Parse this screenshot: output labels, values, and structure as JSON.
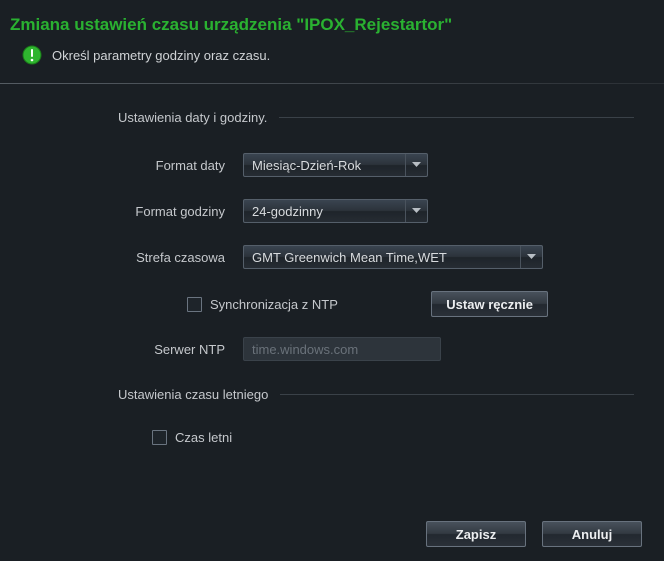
{
  "title": "Zmiana ustawień czasu urządzenia \"IPOX_Rejestartor\"",
  "subtitle": "Określ parametry godziny oraz czasu.",
  "section1": {
    "heading": "Ustawienia daty i godziny.",
    "date_format_label": "Format daty",
    "date_format_value": "Miesiąc-Dzień-Rok",
    "time_format_label": "Format godziny",
    "time_format_value": "24-godzinny",
    "timezone_label": "Strefa czasowa",
    "timezone_value": "GMT Greenwich Mean Time,WET",
    "ntp_sync_label": "Synchronizacja z NTP",
    "ntp_sync_checked": false,
    "manual_set_label": "Ustaw ręcznie",
    "ntp_server_label": "Serwer NTP",
    "ntp_server_value": "time.windows.com"
  },
  "section2": {
    "heading": "Ustawienia czasu letniego",
    "dst_label": "Czas letni",
    "dst_checked": false
  },
  "footer": {
    "save_label": "Zapisz",
    "cancel_label": "Anuluj"
  },
  "icons": {
    "info": "info-icon",
    "chevron": "chevron-down-icon"
  }
}
